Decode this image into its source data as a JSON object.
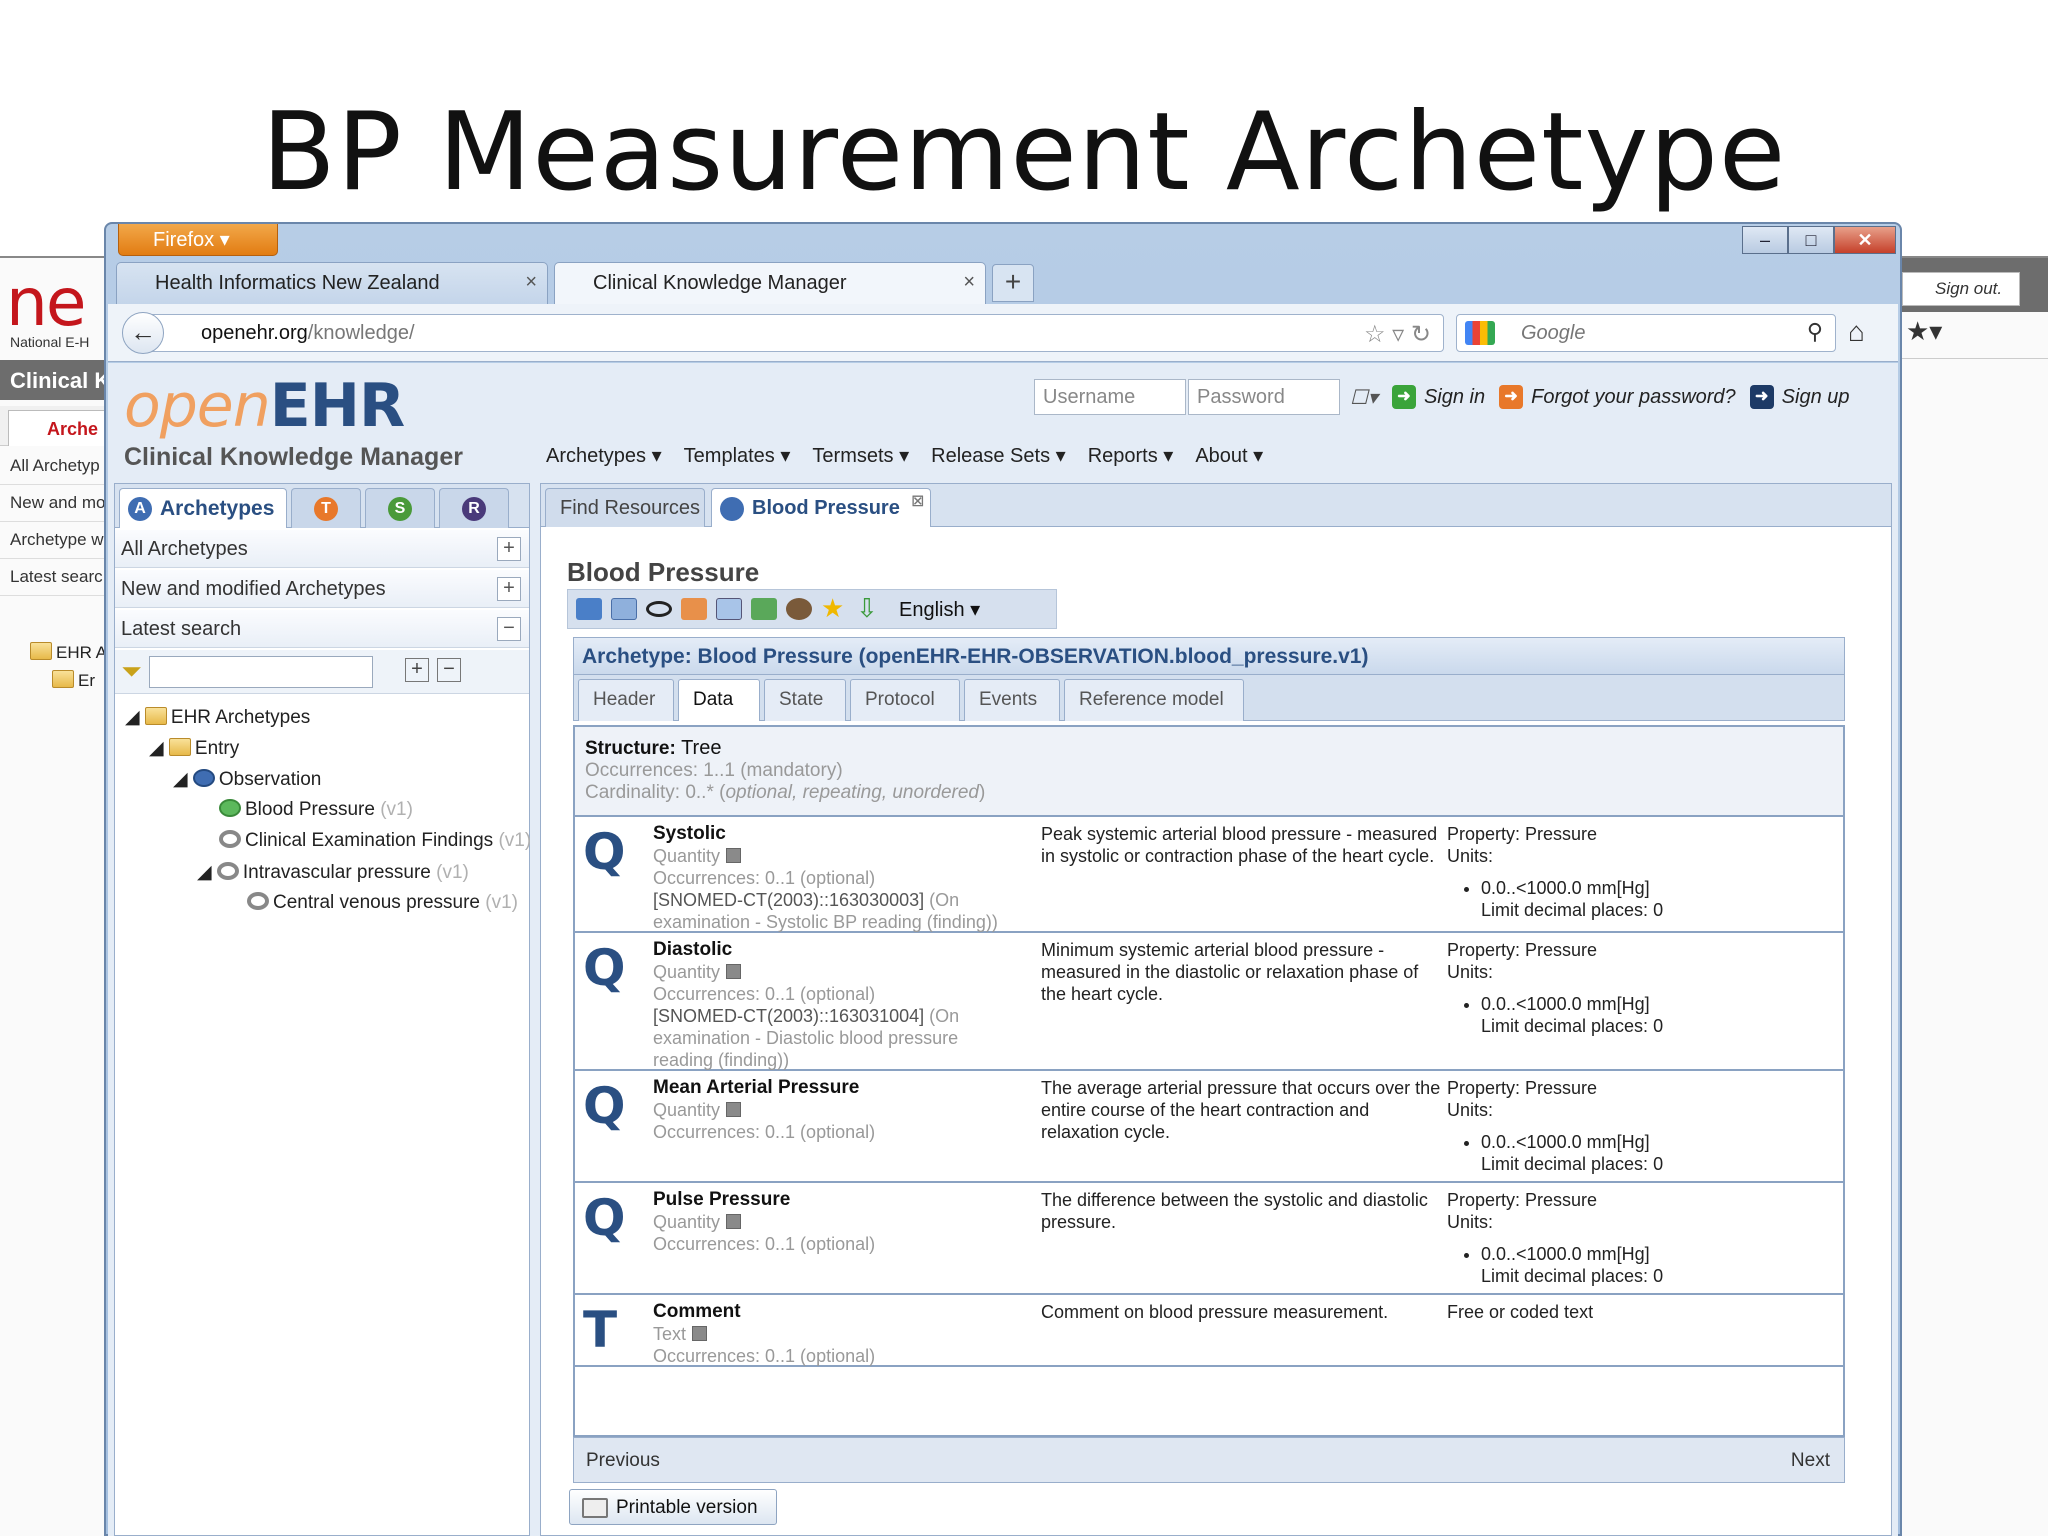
{
  "slide": {
    "title": "BP Measurement Archetype"
  },
  "bg_left": {
    "logo": "ne",
    "subtitle": "National E-H",
    "bar": "Clinical K",
    "tab": "Arche",
    "rows": [
      "All Archetyp",
      "New and mo",
      "Archetype w",
      "Latest searc"
    ],
    "tree": [
      "EHR A",
      "Er"
    ]
  },
  "bg_right": {
    "signout": "Sign out."
  },
  "firefox": {
    "button": "Firefox",
    "tabs": [
      {
        "label": "Health Informatics New Zealand",
        "close": "×"
      },
      {
        "label": "Clinical Knowledge Manager",
        "close": "×"
      }
    ],
    "new_tab": "+",
    "url_host": "openehr.org",
    "url_path": "/knowledge/",
    "search_placeholder": "Google"
  },
  "ckm": {
    "logo_open": "open",
    "logo_ehr": "EHR",
    "subtitle": "Clinical Knowledge Manager",
    "username_placeholder": "Username",
    "password_placeholder": "Password",
    "sign_in": "Sign in",
    "forgot": "Forgot your password?",
    "sign_up": "Sign up",
    "menu": [
      "Archetypes ▾",
      "Templates ▾",
      "Termsets ▾",
      "Release Sets ▾",
      "Reports ▾",
      "About ▾"
    ]
  },
  "left_panel": {
    "tab_label": "Archetypes",
    "tab_letters": [
      "T",
      "S",
      "R"
    ],
    "sections": [
      {
        "label": "All Archetypes",
        "toggle": "+"
      },
      {
        "label": "New and modified Archetypes",
        "toggle": "+"
      },
      {
        "label": "Latest search",
        "toggle": "−"
      }
    ],
    "tree": [
      {
        "label": "EHR Archetypes",
        "version": ""
      },
      {
        "label": "Entry",
        "version": ""
      },
      {
        "label": "Observation",
        "version": ""
      },
      {
        "label": "Blood Pressure",
        "version": "(v1)"
      },
      {
        "label": "Clinical Examination Findings",
        "version": "(v1)"
      },
      {
        "label": "Intravascular pressure",
        "version": "(v1)"
      },
      {
        "label": "Central venous pressure",
        "version": "(v1)"
      }
    ]
  },
  "right_panel": {
    "tabs": [
      "Find Resources",
      "Blood Pressure"
    ],
    "heading": "Blood Pressure",
    "language": "English ▾",
    "archetype_title": "Archetype: Blood Pressure (openEHR-EHR-OBSERVATION.blood_pressure.v1)",
    "detail_tabs": [
      "Header",
      "Data",
      "State",
      "Protocol",
      "Events",
      "Reference model"
    ],
    "structure": {
      "label": "Structure:",
      "value": "Tree",
      "occurrences": "Occurrences: 1..1 (mandatory)",
      "cardinality_prefix": "Cardinality: 0..* (",
      "cardinality_detail": "optional, repeating, unordered",
      "cardinality_suffix": ")"
    },
    "rows": [
      {
        "letter": "Q",
        "name": "Systolic",
        "type": "Quantity",
        "occurrences": "Occurrences: 0..1 (optional)",
        "snomed": "[SNOMED-CT(2003)::163030003]",
        "snomed_text": "(On examination - Systolic BP reading (finding))",
        "description": "Peak systemic arterial blood pressure - measured in systolic or contraction phase of the heart cycle.",
        "property": "Property: Pressure",
        "units_label": "Units:",
        "range": "0.0..<1000.0 mm[Hg]",
        "decimals": "Limit decimal places: 0"
      },
      {
        "letter": "Q",
        "name": "Diastolic",
        "type": "Quantity",
        "occurrences": "Occurrences: 0..1 (optional)",
        "snomed": "[SNOMED-CT(2003)::163031004]",
        "snomed_text": "(On examination - Diastolic blood pressure reading (finding))",
        "description": "Minimum systemic arterial blood pressure - measured in the diastolic or relaxation phase of the heart cycle.",
        "property": "Property: Pressure",
        "units_label": "Units:",
        "range": "0.0..<1000.0 mm[Hg]",
        "decimals": "Limit decimal places: 0"
      },
      {
        "letter": "Q",
        "name": "Mean Arterial Pressure",
        "type": "Quantity",
        "occurrences": "Occurrences: 0..1 (optional)",
        "description": "The average arterial pressure that occurs over the entire course of the heart contraction and relaxation cycle.",
        "property": "Property: Pressure",
        "units_label": "Units:",
        "range": "0.0..<1000.0 mm[Hg]",
        "decimals": "Limit decimal places: 0"
      },
      {
        "letter": "Q",
        "name": "Pulse Pressure",
        "type": "Quantity",
        "occurrences": "Occurrences: 0..1 (optional)",
        "description": "The difference between the systolic and diastolic pressure.",
        "property": "Property: Pressure",
        "units_label": "Units:",
        "range": "0.0..<1000.0 mm[Hg]",
        "decimals": "Limit decimal places: 0"
      },
      {
        "letter": "T",
        "name": "Comment",
        "type": "Text",
        "occurrences": "Occurrences: 0..1 (optional)",
        "description": "Comment on blood pressure measurement.",
        "value_type": "Free or coded text"
      }
    ],
    "previous": "Previous",
    "next": "Next",
    "printable": "Printable version"
  },
  "colors": {
    "accent_blue": "#2a4f82",
    "firefox_orange": "#e27c12",
    "brand_red": "#c4161c"
  }
}
